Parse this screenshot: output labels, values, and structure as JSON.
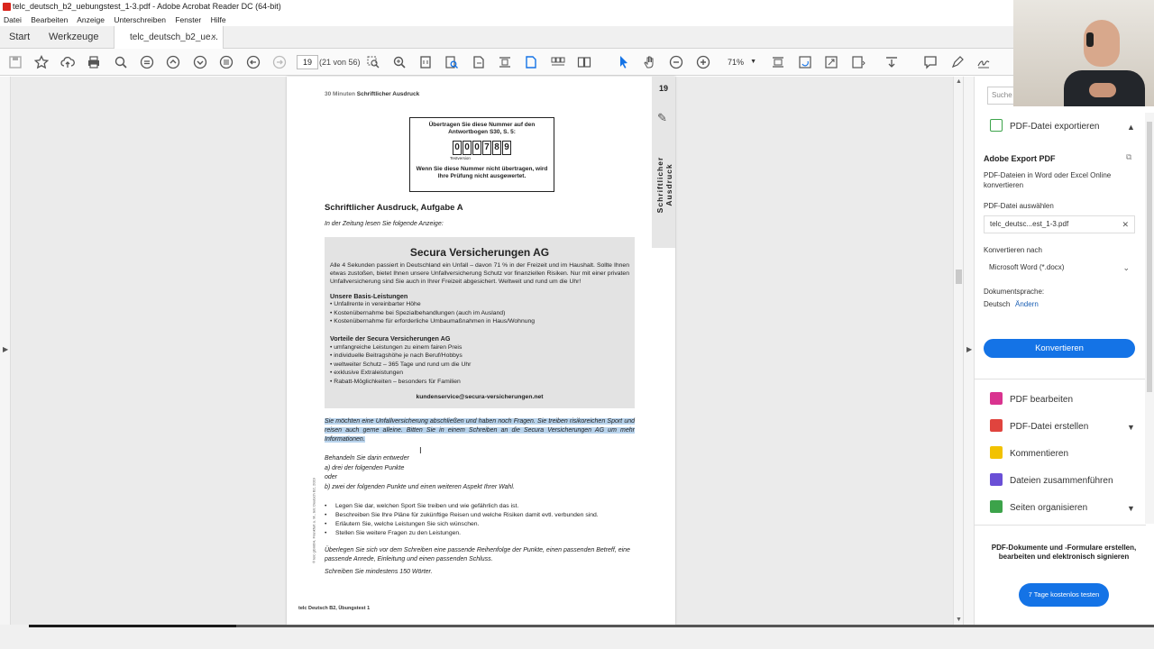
{
  "window": {
    "title": "telc_deutsch_b2_uebungstest_1-3.pdf - Adobe Acrobat Reader DC (64-bit)"
  },
  "menu": [
    "Datei",
    "Bearbeiten",
    "Anzeige",
    "Unterschreiben",
    "Fenster",
    "Hilfe"
  ],
  "tabs": {
    "home": "Start",
    "tools": "Werkzeuge",
    "doc": "telc_deutsch_b2_ue...",
    "close": "×"
  },
  "toolbar": {
    "page_current": "19",
    "page_count": "(21 von 56)",
    "zoom": "71%"
  },
  "page": {
    "number": "19",
    "header_gray": "30 Minuten",
    "header_bold": "Schriftlicher Ausdruck",
    "side_label": "Schriftlicher Ausdruck",
    "numbox_line1": "Übertragen Sie diese Nummer auf den Antwortbogen S30, S. 5:",
    "digits": [
      "0",
      "0",
      "0",
      "7",
      "8",
      "9"
    ],
    "numbox_tv": "Testversion",
    "numbox_line2": "Wenn Sie diese Nummer nicht übertragen, wird Ihre Prüfung nicht ausgewertet.",
    "section_title": "Schriftlicher Ausdruck, Aufgabe A",
    "intro": "In der Zeitung lesen Sie folgende Anzeige:",
    "ad": {
      "title": "Secura Versicherungen AG",
      "intro": "Alle 4 Sekunden passiert in Deutschland ein Unfall – davon 71 % in der Freizeit und im Haushalt. Sollte Ihnen etwas zustoßen, bietet Ihnen unsere Unfallversicherung Schutz vor finanziellen Risiken. Nur mit einer privaten Unfallversicherung sind Sie auch in Ihrer Freizeit abgesichert. Weltweit und rund um die Uhr!",
      "basis_title": "Unsere Basis-Leistungen",
      "basis": [
        "Unfallrente in vereinbarter Höhe",
        "Kostenübernahme bei Spezialbehandlungen (auch im Ausland)",
        "Kostenübernahme für erforderliche Umbaumaßnahmen in Haus/Wohnung"
      ],
      "vorteile_title": "Vorteile der Secura Versicherungen AG",
      "vorteile": [
        "umfangreiche Leistungen zu einem fairen Preis",
        "individuelle Beitragshöhe je nach Beruf/Hobbys",
        "weltweiter Schutz – 365 Tage und rund um die Uhr",
        "exklusive Extraleistungen",
        "Rabatt-Möglichkeiten – besonders für Familien"
      ],
      "email": "kundenservice@secura-versicherungen.net"
    },
    "task": "Sie möchten eine Unfallversicherung abschließen und haben noch Fragen. Sie treiben risikoreichen Sport und reisen auch gerne alleine. Bitten Sie in einem Schreiben an die Secura Versicherungen AG um mehr Informationen.",
    "choose": [
      "Behandeln Sie darin entweder",
      "a)  drei der folgenden Punkte",
      "oder",
      "b)  zwei der folgenden Punkte und einen weiteren Aspekt Ihrer Wahl."
    ],
    "points": [
      "Legen Sie dar, welchen Sport Sie treiben und wie gefährlich das ist.",
      "Beschreiben Sie Ihre Pläne für zukünftige Reisen und welche Risiken damit evtl. verbunden sind.",
      "Erläutern Sie, welche Leistungen Sie sich wünschen.",
      "Stellen Sie weitere Fragen zu den Leistungen."
    ],
    "final": "Überlegen Sie sich vor dem Schreiben eine passende Reihenfolge der Punkte, einen passenden Betreff, eine passende Anrede, Einleitung und einen passenden Schluss.",
    "final2": "Schreiben Sie mindestens 150 Wörter.",
    "copyright": "© telc gGmbH, Frankfurt a. M., telc Deutsch B2, 2019",
    "footer": "telc Deutsch B2, Übungstest 1"
  },
  "right_panel": {
    "search_placeholder": "Suche",
    "export_title": "PDF-Datei exportieren",
    "adobe_export": "Adobe Export PDF",
    "desc": "PDF-Dateien in Word oder Excel Online konvertieren",
    "select_label": "PDF-Datei auswählen",
    "file": "telc_deutsc...est_1-3.pdf",
    "convert_to_label": "Konvertieren nach",
    "format": "Microsoft Word (*.docx)",
    "lang_label": "Dokumentsprache:",
    "lang": "Deutsch",
    "lang_change": "Ändern",
    "convert_button": "Konvertieren",
    "tools": [
      {
        "label": "PDF bearbeiten",
        "color": "#d9338f"
      },
      {
        "label": "PDF-Datei erstellen",
        "color": "#e0443e"
      },
      {
        "label": "Kommentieren",
        "color": "#f2c200"
      },
      {
        "label": "Dateien zusammenführen",
        "color": "#6a4fd6"
      },
      {
        "label": "Seiten organisieren",
        "color": "#3ca34a"
      }
    ],
    "promo": "PDF-Dokumente und -Formulare erstellen, bearbeiten und elektronisch signieren",
    "promo_button": "7 Tage kostenlos testen"
  },
  "colors": {
    "accent": "#1473e6",
    "highlight": "#b8d3ec"
  }
}
